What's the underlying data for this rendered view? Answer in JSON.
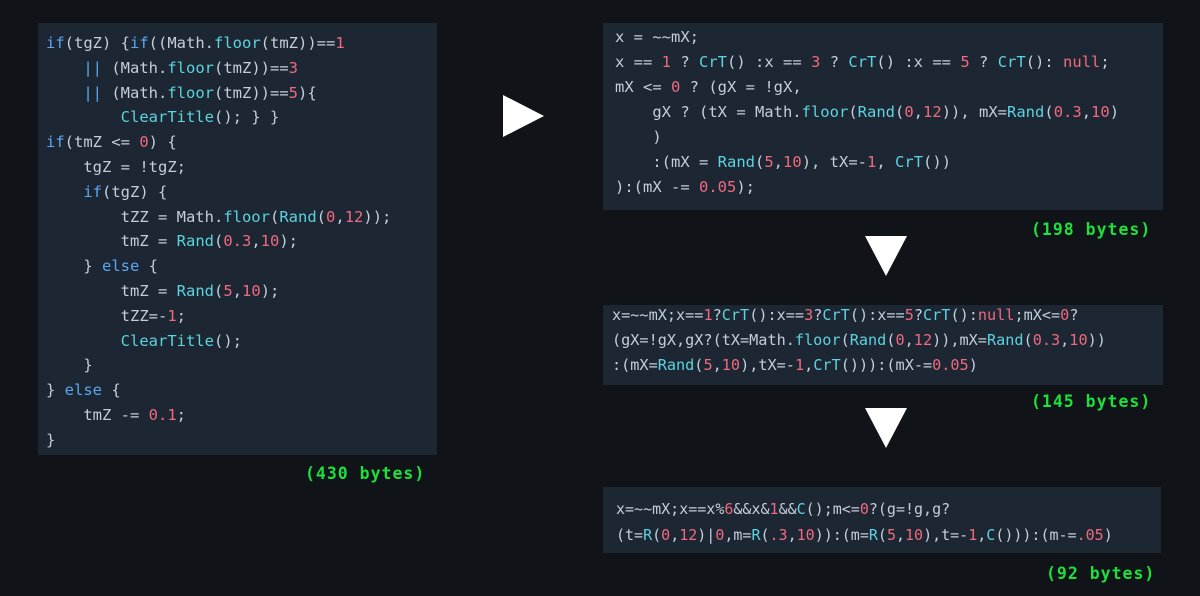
{
  "colors": {
    "background": "#101317",
    "panel": "#1d2733",
    "text": "#c2cedb",
    "keyword": "#5aa6ef",
    "number": "#ef6a7e",
    "function": "#5cd3de",
    "bytes_label": "#1ee03a",
    "arrow": "#ffffff"
  },
  "snippets": [
    {
      "bytes_label": "(430 bytes)",
      "lines": [
        [
          [
            "if",
            "k"
          ],
          [
            "(tgZ) {",
            "t"
          ],
          [
            "if",
            "k"
          ],
          [
            "((Math.",
            "t"
          ],
          [
            "floor",
            "f"
          ],
          [
            "(tmZ))==",
            "t"
          ],
          [
            "1",
            "n"
          ]
        ],
        [
          [
            "    ",
            "t"
          ],
          [
            "||",
            "k"
          ],
          [
            " (Math.",
            "t"
          ],
          [
            "floor",
            "f"
          ],
          [
            "(tmZ))==",
            "t"
          ],
          [
            "3",
            "n"
          ]
        ],
        [
          [
            "    ",
            "t"
          ],
          [
            "||",
            "k"
          ],
          [
            " (Math.",
            "t"
          ],
          [
            "floor",
            "f"
          ],
          [
            "(tmZ))==",
            "t"
          ],
          [
            "5",
            "n"
          ],
          [
            "){",
            "t"
          ]
        ],
        [
          [
            "        ",
            "t"
          ],
          [
            "ClearTitle",
            "f"
          ],
          [
            "(); } }",
            "t"
          ]
        ],
        [
          [
            "if",
            "k"
          ],
          [
            "(tmZ <= ",
            "t"
          ],
          [
            "0",
            "n"
          ],
          [
            ") {",
            "t"
          ]
        ],
        [
          [
            "    tgZ = !tgZ;",
            "t"
          ]
        ],
        [
          [
            "    ",
            "t"
          ],
          [
            "if",
            "k"
          ],
          [
            "(tgZ) {",
            "t"
          ]
        ],
        [
          [
            "        tZZ = Math.",
            "t"
          ],
          [
            "floor",
            "f"
          ],
          [
            "(",
            "t"
          ],
          [
            "Rand",
            "f"
          ],
          [
            "(",
            "t"
          ],
          [
            "0",
            "n"
          ],
          [
            ",",
            "t"
          ],
          [
            "12",
            "n"
          ],
          [
            "));",
            "t"
          ]
        ],
        [
          [
            "        tmZ = ",
            "t"
          ],
          [
            "Rand",
            "f"
          ],
          [
            "(",
            "t"
          ],
          [
            "0.3",
            "n"
          ],
          [
            ",",
            "t"
          ],
          [
            "10",
            "n"
          ],
          [
            ");",
            "t"
          ]
        ],
        [
          [
            "    } ",
            "t"
          ],
          [
            "else",
            "k"
          ],
          [
            " {",
            "t"
          ]
        ],
        [
          [
            "        tmZ = ",
            "t"
          ],
          [
            "Rand",
            "f"
          ],
          [
            "(",
            "t"
          ],
          [
            "5",
            "n"
          ],
          [
            ",",
            "t"
          ],
          [
            "10",
            "n"
          ],
          [
            ");",
            "t"
          ]
        ],
        [
          [
            "        tZZ=-",
            "t"
          ],
          [
            "1",
            "n"
          ],
          [
            ";",
            "t"
          ]
        ],
        [
          [
            "        ",
            "t"
          ],
          [
            "ClearTitle",
            "f"
          ],
          [
            "();",
            "t"
          ]
        ],
        [
          [
            "    }",
            "t"
          ]
        ],
        [
          [
            "} ",
            "t"
          ],
          [
            "else",
            "k"
          ],
          [
            " {",
            "t"
          ]
        ],
        [
          [
            "    tmZ -= ",
            "t"
          ],
          [
            "0.1",
            "n"
          ],
          [
            ";",
            "t"
          ]
        ],
        [
          [
            "}",
            "t"
          ]
        ]
      ]
    },
    {
      "bytes_label": "(198 bytes)",
      "lines": [
        [
          [
            "x = ~~mX;",
            "t"
          ]
        ],
        [
          [
            "x == ",
            "t"
          ],
          [
            "1",
            "n"
          ],
          [
            " ? ",
            "t"
          ],
          [
            "CrT",
            "f"
          ],
          [
            "() :x == ",
            "t"
          ],
          [
            "3",
            "n"
          ],
          [
            " ? ",
            "t"
          ],
          [
            "CrT",
            "f"
          ],
          [
            "() :x == ",
            "t"
          ],
          [
            "5",
            "n"
          ],
          [
            " ? ",
            "t"
          ],
          [
            "CrT",
            "f"
          ],
          [
            "(): ",
            "t"
          ],
          [
            "null",
            "n"
          ],
          [
            ";",
            "t"
          ]
        ],
        [
          [
            "mX <= ",
            "t"
          ],
          [
            "0",
            "n"
          ],
          [
            " ? (gX = !gX,",
            "t"
          ]
        ],
        [
          [
            "    gX ? (tX = Math.",
            "t"
          ],
          [
            "floor",
            "f"
          ],
          [
            "(",
            "t"
          ],
          [
            "Rand",
            "f"
          ],
          [
            "(",
            "t"
          ],
          [
            "0",
            "n"
          ],
          [
            ",",
            "t"
          ],
          [
            "12",
            "n"
          ],
          [
            ")), mX=",
            "t"
          ],
          [
            "Rand",
            "f"
          ],
          [
            "(",
            "t"
          ],
          [
            "0.3",
            "n"
          ],
          [
            ",",
            "t"
          ],
          [
            "10",
            "n"
          ],
          [
            ")",
            "t"
          ]
        ],
        [
          [
            "    )",
            "t"
          ]
        ],
        [
          [
            "    :(mX = ",
            "t"
          ],
          [
            "Rand",
            "f"
          ],
          [
            "(",
            "t"
          ],
          [
            "5",
            "n"
          ],
          [
            ",",
            "t"
          ],
          [
            "10",
            "n"
          ],
          [
            "), tX=-",
            "t"
          ],
          [
            "1",
            "n"
          ],
          [
            ", ",
            "t"
          ],
          [
            "CrT",
            "f"
          ],
          [
            "())",
            "t"
          ]
        ],
        [
          [
            "):(mX -= ",
            "t"
          ],
          [
            "0.05",
            "n"
          ],
          [
            ");",
            "t"
          ]
        ]
      ]
    },
    {
      "bytes_label": "(145 bytes)",
      "lines": [
        [
          [
            "x=~~mX;x==",
            "t"
          ],
          [
            "1",
            "n"
          ],
          [
            "?",
            "t"
          ],
          [
            "CrT",
            "f"
          ],
          [
            "():x==",
            "t"
          ],
          [
            "3",
            "n"
          ],
          [
            "?",
            "t"
          ],
          [
            "CrT",
            "f"
          ],
          [
            "():x==",
            "t"
          ],
          [
            "5",
            "n"
          ],
          [
            "?",
            "t"
          ],
          [
            "CrT",
            "f"
          ],
          [
            "():",
            "t"
          ],
          [
            "null",
            "n"
          ],
          [
            ";mX<=",
            "t"
          ],
          [
            "0",
            "n"
          ],
          [
            "?",
            "t"
          ]
        ],
        [
          [
            "(gX=!gX,gX?(tX=Math.",
            "t"
          ],
          [
            "floor",
            "f"
          ],
          [
            "(",
            "t"
          ],
          [
            "Rand",
            "f"
          ],
          [
            "(",
            "t"
          ],
          [
            "0",
            "n"
          ],
          [
            ",",
            "t"
          ],
          [
            "12",
            "n"
          ],
          [
            ")),mX=",
            "t"
          ],
          [
            "Rand",
            "f"
          ],
          [
            "(",
            "t"
          ],
          [
            "0.3",
            "n"
          ],
          [
            ",",
            "t"
          ],
          [
            "10",
            "n"
          ],
          [
            "))",
            "t"
          ]
        ],
        [
          [
            ":(mX=",
            "t"
          ],
          [
            "Rand",
            "f"
          ],
          [
            "(",
            "t"
          ],
          [
            "5",
            "n"
          ],
          [
            ",",
            "t"
          ],
          [
            "10",
            "n"
          ],
          [
            "),tX=-",
            "t"
          ],
          [
            "1",
            "n"
          ],
          [
            ",",
            "t"
          ],
          [
            "CrT",
            "f"
          ],
          [
            "())):(mX-=",
            "t"
          ],
          [
            "0.05",
            "n"
          ],
          [
            ")",
            "t"
          ]
        ]
      ]
    },
    {
      "bytes_label": "(92 bytes)",
      "lines": [
        [
          [
            "x=~~mX;x==x%",
            "t"
          ],
          [
            "6",
            "n"
          ],
          [
            "&&x&",
            "t"
          ],
          [
            "1",
            "n"
          ],
          [
            "&&",
            "t"
          ],
          [
            "C",
            "f"
          ],
          [
            "();m<=",
            "t"
          ],
          [
            "0",
            "n"
          ],
          [
            "?(g=!g,g?",
            "t"
          ]
        ],
        [
          [
            "(t=",
            "t"
          ],
          [
            "R",
            "f"
          ],
          [
            "(",
            "t"
          ],
          [
            "0",
            "n"
          ],
          [
            ",",
            "t"
          ],
          [
            "12",
            "n"
          ],
          [
            ")|",
            "t"
          ],
          [
            "0",
            "n"
          ],
          [
            ",m=",
            "t"
          ],
          [
            "R",
            "f"
          ],
          [
            "(",
            "t"
          ],
          [
            ".3",
            "n"
          ],
          [
            ",",
            "t"
          ],
          [
            "10",
            "n"
          ],
          [
            ")):(m=",
            "t"
          ],
          [
            "R",
            "f"
          ],
          [
            "(",
            "t"
          ],
          [
            "5",
            "n"
          ],
          [
            ",",
            "t"
          ],
          [
            "10",
            "n"
          ],
          [
            "),t=-",
            "t"
          ],
          [
            "1",
            "n"
          ],
          [
            ",",
            "t"
          ],
          [
            "C",
            "f"
          ],
          [
            "())):(m-=",
            "t"
          ],
          [
            ".05",
            "n"
          ],
          [
            ")",
            "t"
          ]
        ]
      ]
    }
  ]
}
